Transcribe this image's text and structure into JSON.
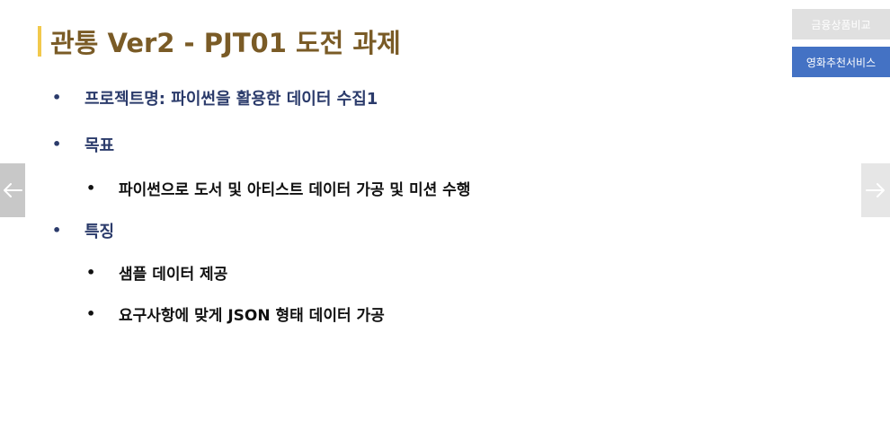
{
  "slide": {
    "title": "관통 Ver2 - PJT01 도전 과제"
  },
  "tabs": [
    {
      "label": "금융상품비교",
      "active": false
    },
    {
      "label": "영화추천서비스",
      "active": true
    }
  ],
  "bullets": {
    "project_name": "프로젝트명: 파이썬을 활용한 데이터 수집1",
    "goal_heading": "목표",
    "goal_item": "파이썬으로 도서 및 아티스트 데이터 가공 및 미션 수행",
    "features_heading": "특징",
    "feature_item_1": "샘플 데이터 제공",
    "feature_item_2": "요구사항에 맞게 JSON 형태 데이터 가공"
  },
  "icons": {
    "prev": "arrow-left-icon",
    "next": "arrow-right-icon"
  },
  "colors": {
    "title": "#7a5b26",
    "title_accent": "#f2c94c",
    "heading": "#2b3b6b",
    "tab_active": "#4472c4",
    "tab_inactive": "#e0e0e0"
  }
}
